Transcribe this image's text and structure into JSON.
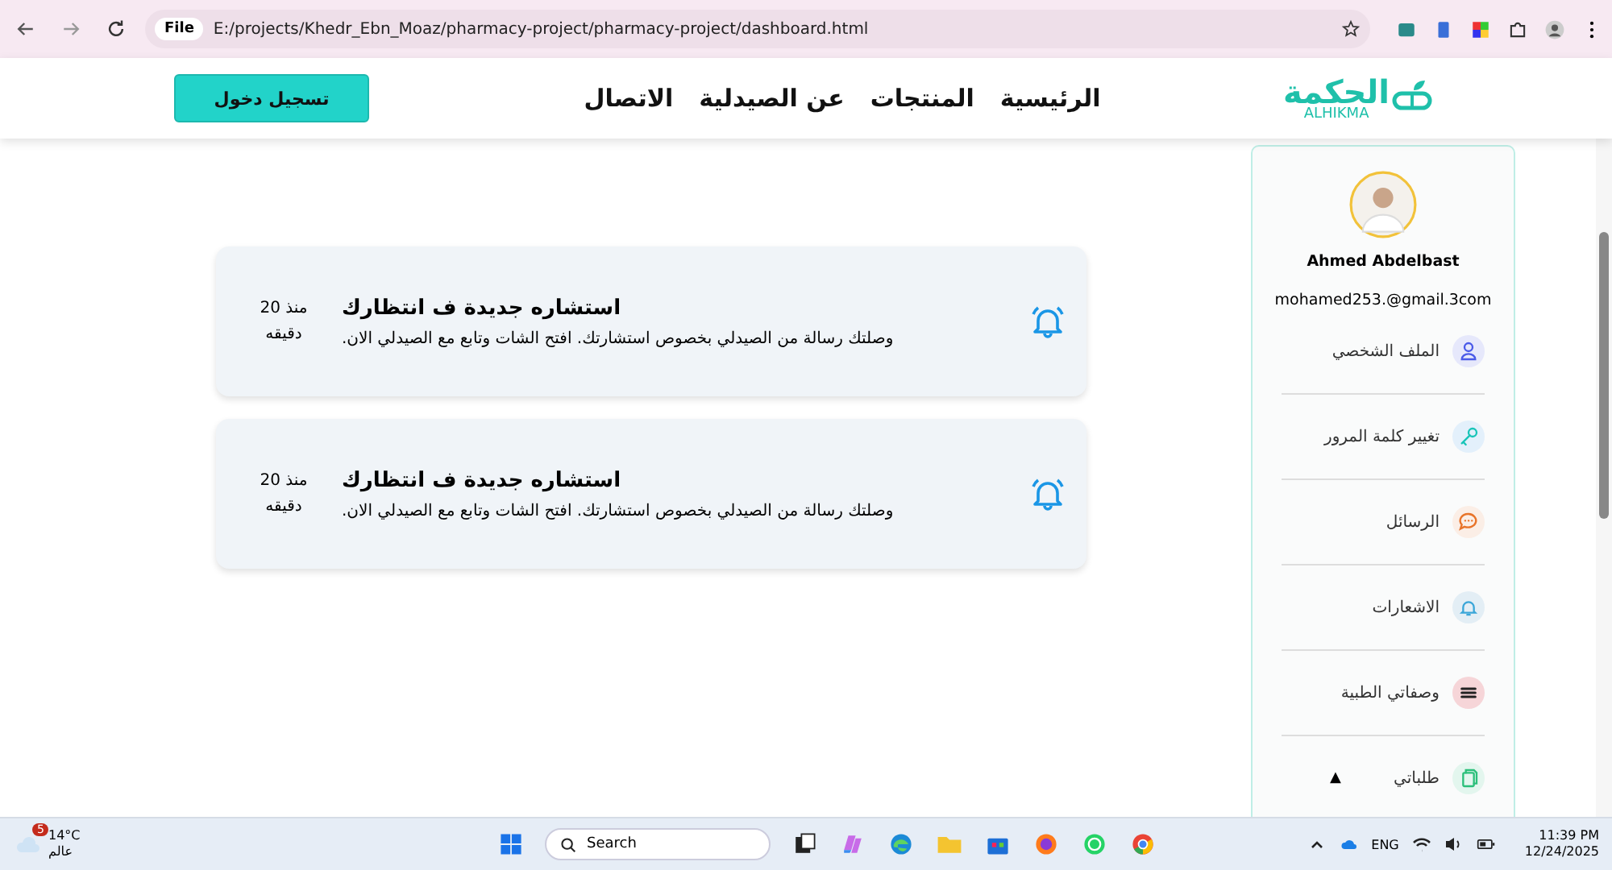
{
  "browser": {
    "scheme": "File",
    "url": "E:/projects/Khedr_Ebn_Moaz/pharmacy-project/pharmacy-project/dashboard.html"
  },
  "header": {
    "logo_arabic": "الحكمة",
    "logo_latin": "ALHIKMA",
    "nav": [
      "الرئيسية",
      "المنتجات",
      "عن الصيدلية",
      "الاتصال"
    ],
    "login_button": "تسجيل دخول"
  },
  "notifications": [
    {
      "title": "استشاره جديدة ف انتظارك",
      "message": "وصلتك رسالة من الصيدلي بخصوص استشارتك. افتح الشات وتابع مع الصيدلي الان.",
      "time": "منذ 20 دقيقه"
    },
    {
      "title": "استشاره جديدة ف انتظارك",
      "message": "وصلتك رسالة من الصيدلي بخصوص استشارتك. افتح الشات وتابع مع الصيدلي الان.",
      "time": "منذ 20 دقيقه"
    }
  ],
  "profile": {
    "name": "Ahmed Abdelbast",
    "email": "mohamed253.@gmail.3com"
  },
  "sidebar": {
    "items": [
      {
        "label": "الملف الشخصي",
        "kind": "user",
        "color": "#e6e8fb"
      },
      {
        "label": "تغيير كلمة المرور",
        "kind": "key",
        "color": "#e3f0fb"
      },
      {
        "label": "الرسائل",
        "kind": "chat",
        "color": "#fbeee6"
      },
      {
        "label": "الاشعارات",
        "kind": "bell",
        "color": "#e3eef5"
      },
      {
        "label": "وصفاتي الطبية",
        "kind": "menu",
        "color": "#f6d5d8"
      },
      {
        "label": "طلباتي",
        "kind": "copy",
        "color": "#e3f6ee",
        "caret": "▲"
      }
    ]
  },
  "taskbar": {
    "weather": {
      "temp": "14°C",
      "place": "عالم",
      "badge": "5"
    },
    "search_placeholder": "Search",
    "language": "ENG",
    "time": "11:39 PM",
    "date": "12/24/2025"
  }
}
